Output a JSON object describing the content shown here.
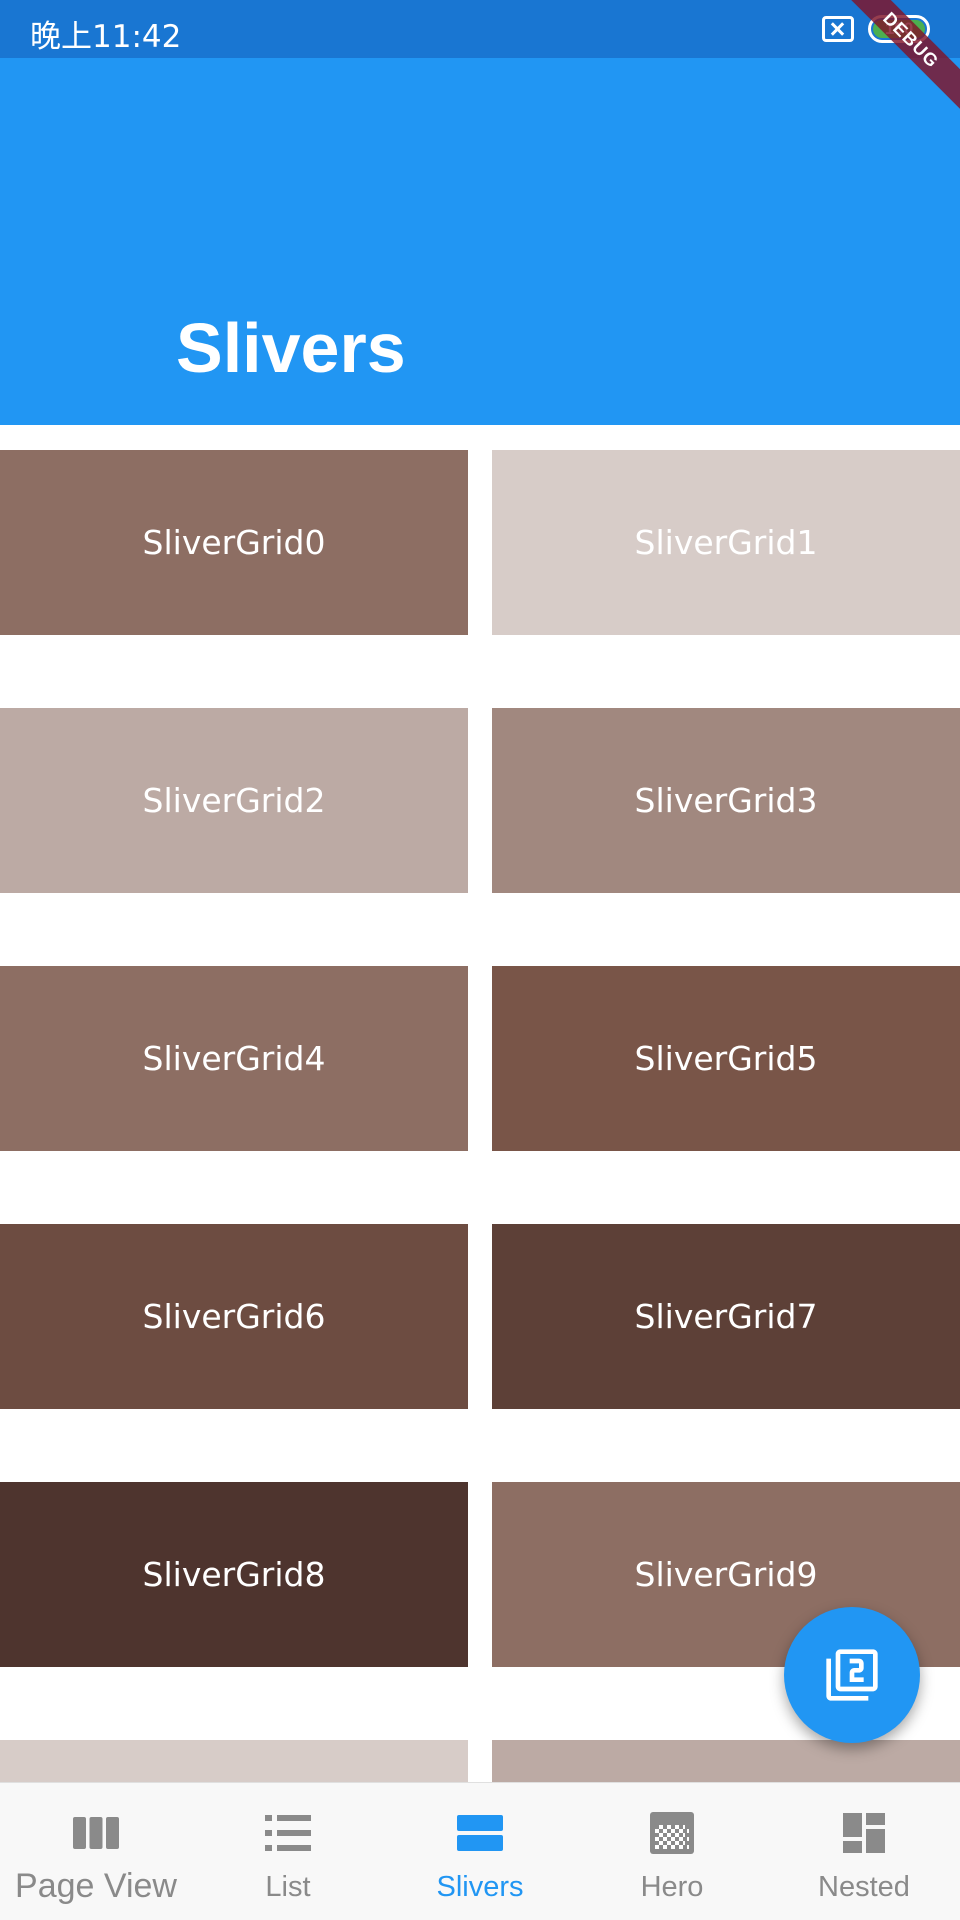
{
  "status_bar": {
    "time": "晚上11:42",
    "battery": "100"
  },
  "debug_banner": "DEBUG",
  "app_bar": {
    "title": "Slivers"
  },
  "grid": {
    "tiles": [
      {
        "label": "SliverGrid0",
        "color": "#8d6e63"
      },
      {
        "label": "SliverGrid1",
        "color": "#d7ccc8"
      },
      {
        "label": "SliverGrid2",
        "color": "#bcaaa4"
      },
      {
        "label": "SliverGrid3",
        "color": "#a1887f"
      },
      {
        "label": "SliverGrid4",
        "color": "#8d6e63"
      },
      {
        "label": "SliverGrid5",
        "color": "#795548"
      },
      {
        "label": "SliverGrid6",
        "color": "#6d4c41"
      },
      {
        "label": "SliverGrid7",
        "color": "#5d4037"
      },
      {
        "label": "SliverGrid8",
        "color": "#4e342e"
      },
      {
        "label": "SliverGrid9",
        "color": "#8d6e63"
      },
      {
        "label": "",
        "color": "#d7ccc8"
      },
      {
        "label": "",
        "color": "#bcaaa4"
      }
    ]
  },
  "fab": {
    "icon": "filter-2-icon",
    "color": "#2196f3"
  },
  "bottom_nav": {
    "items": [
      {
        "label": "Page View",
        "icon": "view-column-icon",
        "active": false
      },
      {
        "label": "List",
        "icon": "list-icon",
        "active": false
      },
      {
        "label": "Slivers",
        "icon": "view-agenda-icon",
        "active": true
      },
      {
        "label": "Hero",
        "icon": "texture-icon",
        "active": false
      },
      {
        "label": "Nested",
        "icon": "dashboard-icon",
        "active": false
      }
    ],
    "active_color": "#2196f3",
    "inactive_color": "#8a8a8a"
  }
}
